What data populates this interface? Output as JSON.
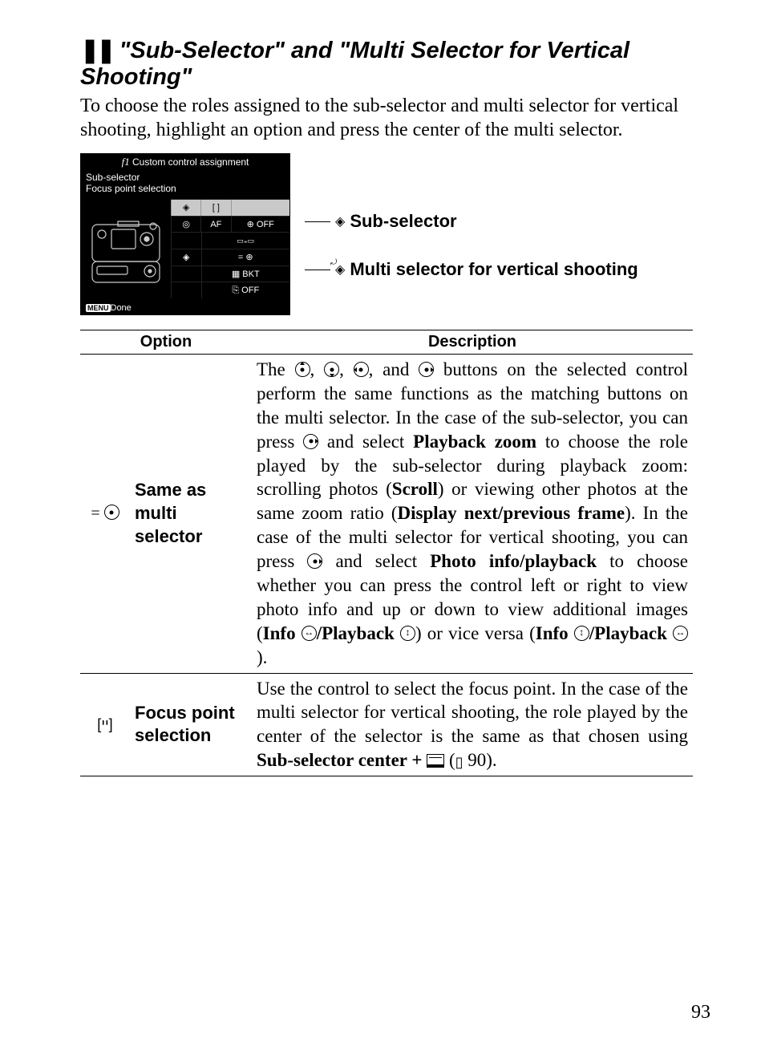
{
  "section": {
    "marker": "❚❚",
    "title": "\"Sub-Selector\" and \"Multi Selector for Vertical Shooting\"",
    "intro": "To choose the roles assigned to the sub-selector and multi selector for vertical shooting, highlight an option and press the center of the multi selector."
  },
  "screenshot": {
    "title_prefix": "f",
    "title_num": "1",
    "title_text": "Custom control assignment",
    "line1": "Sub-selector",
    "line2": "Focus point selection",
    "rows": {
      "r1c1": "◈",
      "r1c2": "[ ]",
      "r2c1": "◎",
      "r2c2": "AF",
      "r2c3": "⊕  OFF",
      "r3c2": "▭₌▭",
      "r4c1": "◈",
      "r4c2": "= ⊕",
      "r5c2": "▦ BKT",
      "r6c2": "⎘ OFF"
    },
    "done_label": "MENU",
    "done_text": "Done"
  },
  "callouts": {
    "sub": "Sub-selector",
    "multi": "Multi selector for vertical shooting"
  },
  "table": {
    "head_option": "Option",
    "head_desc": "Description",
    "row1": {
      "icon_prefix": "= ",
      "name": "Same as multi selector",
      "desc_parts": {
        "t1": "The ",
        "t2": ", ",
        "t3": ", ",
        "t4": ", and ",
        "t5": " buttons on the selected control perform the same functions as the matching buttons on the multi selector. In the case of the sub-selector, you can press ",
        "t6": " and select ",
        "b1": "Playback zoom",
        "t7": " to choose the role played by the sub-selector during playback zoom: scrolling photos (",
        "b2": "Scroll",
        "t8": ") or viewing other photos at the same zoom ratio (",
        "b3": "Display next/previous frame",
        "t9": "). In the case of the multi selector for vertical shooting, you can press ",
        "t10": " and select ",
        "b4": "Photo info/playback",
        "t11": " to choose whether you can press the control left or right to view photo info and up or down to view additional images (",
        "b5": "Info ",
        "b5b": "/Playback ",
        "t12": ") or vice versa (",
        "b6": "Info ",
        "b6b": "/Playback ",
        "t13": ")."
      }
    },
    "row2": {
      "icon": "[יי]",
      "name": "Focus point selection",
      "desc_parts": {
        "t1": "Use the control to select the focus point. In the case of the multi selector for vertical shooting, the role played by the center of the selector is the same as that chosen using ",
        "b1": "Sub-selector center + ",
        "t2": " (",
        "t3": " 90)."
      }
    }
  },
  "page_number": "93"
}
